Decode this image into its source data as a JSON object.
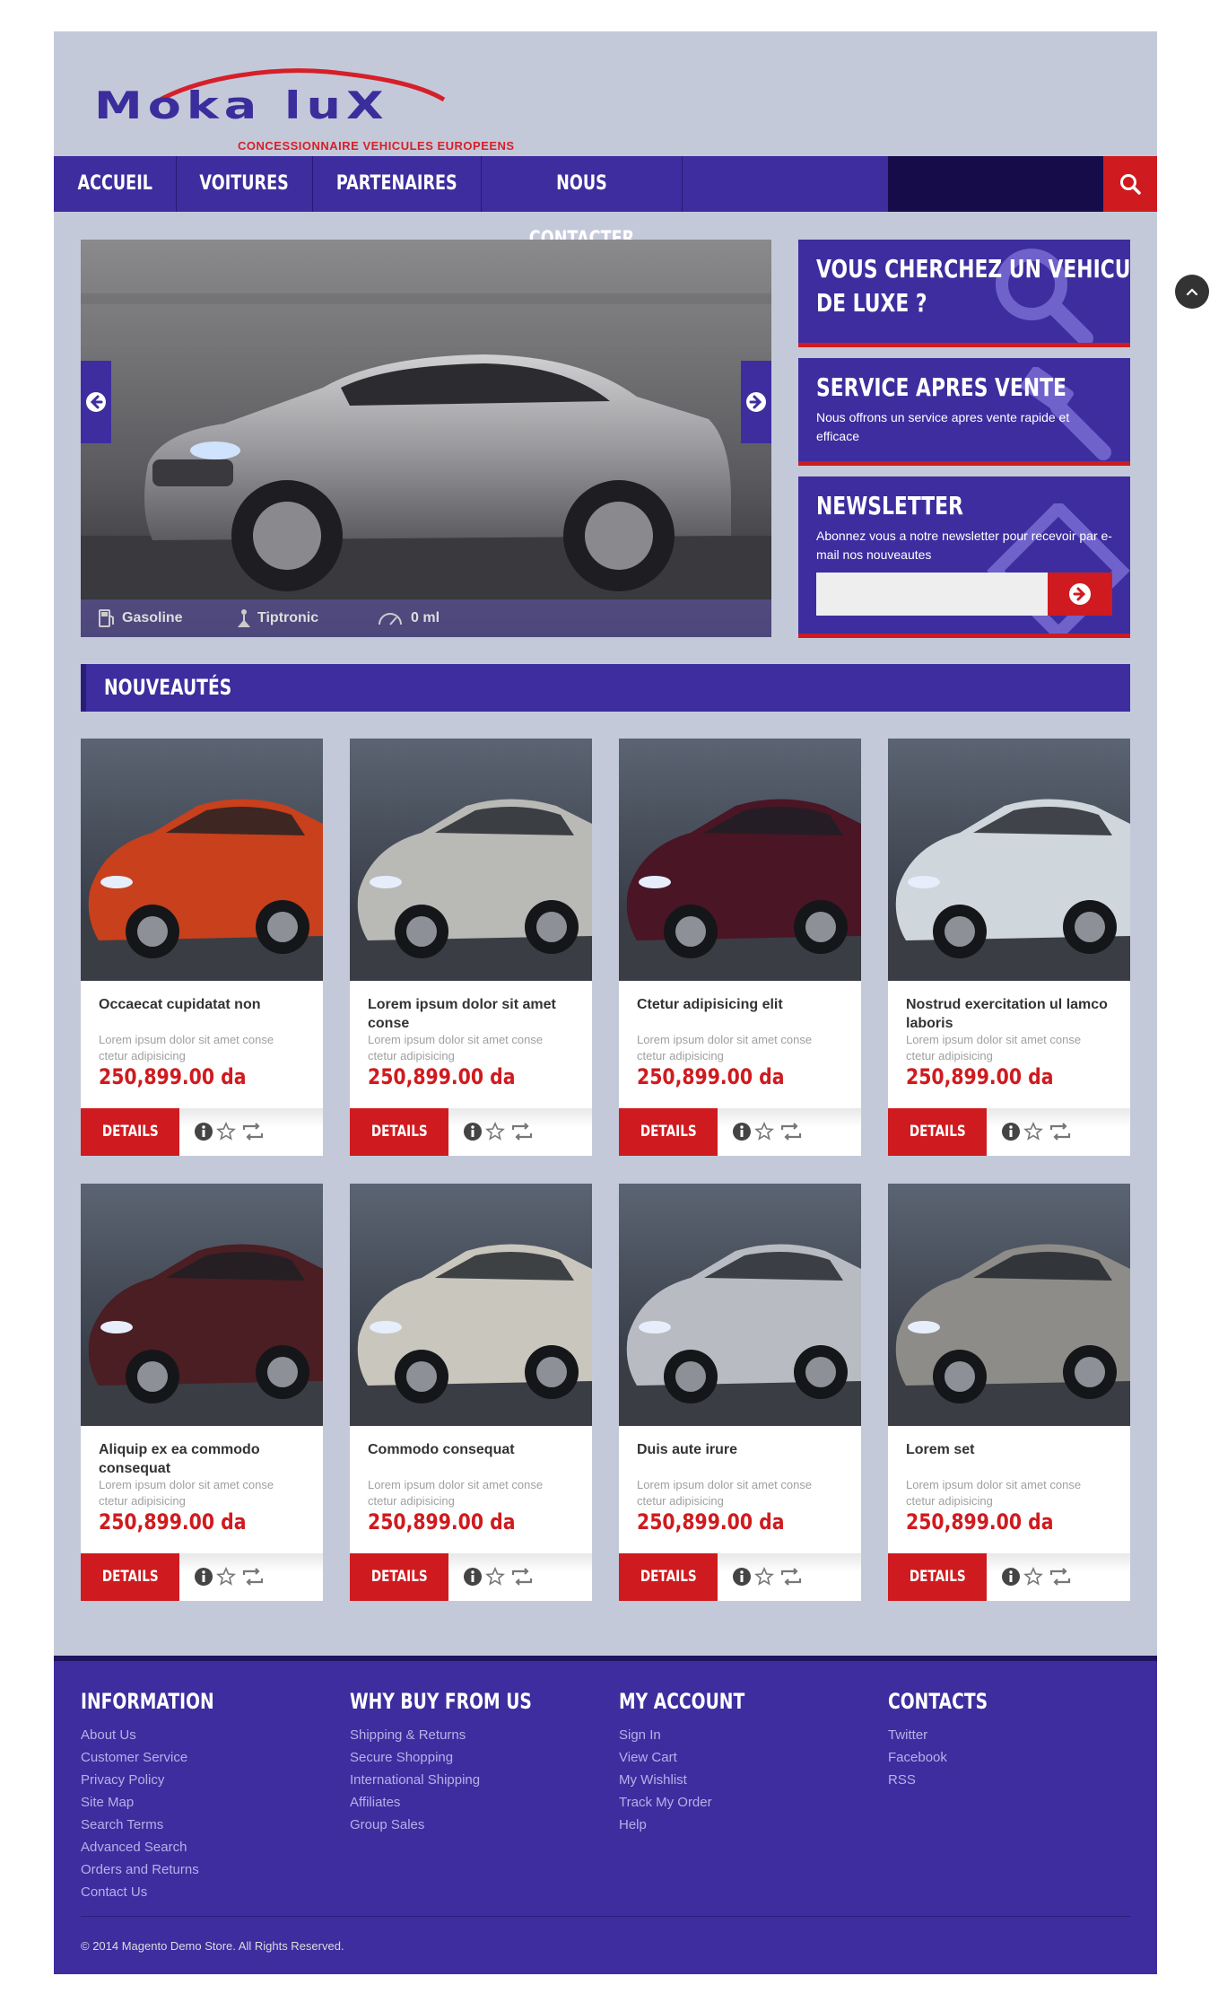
{
  "brand": {
    "name": "Moka luX",
    "tagline": "CONCESSIONNAIRE VEHICULES EUROPEENS",
    "color_primary": "#3d2d9e",
    "color_accent": "#cf1b1f"
  },
  "nav": {
    "items": [
      "ACCUEIL",
      "VOITURES",
      "PARTENAIRES",
      "NOUS CONTACTER"
    ],
    "search_placeholder": "",
    "search_icon": "search-icon"
  },
  "slider": {
    "specs": [
      {
        "icon": "fuel-pump-icon",
        "label": "Gasoline"
      },
      {
        "icon": "gear-shift-icon",
        "label": "Tiptronic"
      },
      {
        "icon": "speedometer-icon",
        "label": "0 ml"
      }
    ]
  },
  "promos": [
    {
      "title_line1": "VOUS CHERCHEZ UN VEHICULE",
      "title_line2": "DE LUXE ?",
      "icon": "magnifier-icon"
    },
    {
      "title": "SERVICE APRES VENTE",
      "text": "Nous offrons un service apres vente rapide et efficace",
      "icon": "gavel-icon"
    },
    {
      "title": "NEWSLETTER",
      "text": "Abonnez vous a notre newsletter pour recevoir par e-mail nos nouveautes",
      "input_placeholder": "",
      "icon": "envelope-icon"
    }
  ],
  "section": {
    "title": "NOUVEAUTÉS"
  },
  "products": [
    {
      "name": "Occaecat cupidatat non",
      "desc": "Lorem ipsum dolor sit amet conse ctetur adipisicing",
      "price": "250,899.00 da",
      "details": "DETAILS",
      "color": "#c8401c"
    },
    {
      "name": "Lorem ipsum dolor sit amet conse",
      "desc": "Lorem ipsum dolor sit amet conse ctetur adipisicing",
      "price": "250,899.00 da",
      "details": "DETAILS",
      "color": "#b9b9b6"
    },
    {
      "name": "Ctetur adipisicing elit",
      "desc": "Lorem ipsum dolor sit amet conse ctetur adipisicing",
      "price": "250,899.00 da",
      "details": "DETAILS",
      "color": "#4a1524"
    },
    {
      "name": "Nostrud exercitation ul lamco laboris",
      "desc": "Lorem ipsum dolor sit amet conse ctetur adipisicing",
      "price": "250,899.00 da",
      "details": "DETAILS",
      "color": "#cfd6dc"
    },
    {
      "name": "Aliquip ex ea commodo consequat",
      "desc": "Lorem ipsum dolor sit amet conse ctetur adipisicing",
      "price": "250,899.00 da",
      "details": "DETAILS",
      "color": "#4a1e22"
    },
    {
      "name": "Commodo consequat",
      "desc": "Lorem ipsum dolor sit amet conse ctetur adipisicing",
      "price": "250,899.00 da",
      "details": "DETAILS",
      "color": "#c9c6bd"
    },
    {
      "name": "Duis aute irure",
      "desc": "Lorem ipsum dolor sit amet conse ctetur adipisicing",
      "price": "250,899.00 da",
      "details": "DETAILS",
      "color": "#b8bcc2"
    },
    {
      "name": "Lorem set",
      "desc": "Lorem ipsum dolor sit amet conse ctetur adipisicing",
      "price": "250,899.00 da",
      "details": "DETAILS",
      "color": "#8e8c88"
    }
  ],
  "footer": {
    "columns": [
      {
        "title": "INFORMATION",
        "links": [
          "About Us",
          "Customer Service",
          "Privacy Policy",
          "Site Map",
          "Search Terms",
          "Advanced Search",
          "Orders and Returns",
          "Contact Us"
        ]
      },
      {
        "title": "WHY BUY FROM US",
        "links": [
          "Shipping & Returns",
          "Secure Shopping",
          "International Shipping",
          "Affiliates",
          "Group Sales"
        ]
      },
      {
        "title": "MY ACCOUNT",
        "links": [
          "Sign In",
          "View Cart",
          "My Wishlist",
          "Track My Order",
          "Help"
        ]
      },
      {
        "title": "CONTACTS",
        "links": [
          "Twitter",
          "Facebook",
          "RSS"
        ]
      }
    ],
    "copyright": "© 2014 Magento Demo Store. All Rights Reserved."
  }
}
